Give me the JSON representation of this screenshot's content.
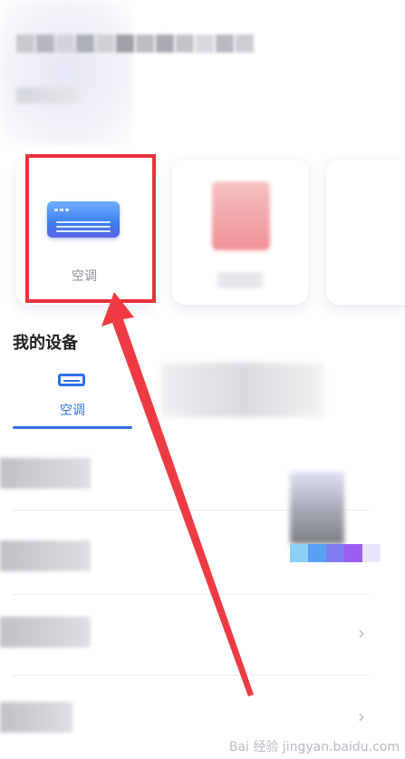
{
  "devices": {
    "ac_card_label": "空调"
  },
  "section_title": "我的设备",
  "tabs": {
    "active_label": "空调"
  },
  "list": {
    "chevron": "›"
  },
  "watermark": "Bai 经验 jingyan.baidu.com",
  "colors": {
    "accent": "#2f6fe8",
    "highlight_red": "#e8333a"
  }
}
